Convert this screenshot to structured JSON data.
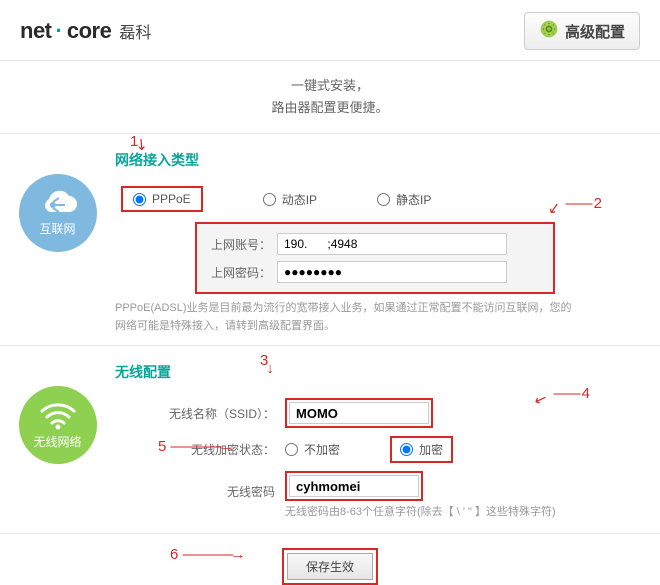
{
  "header": {
    "logo_net": "net",
    "logo_core": "core",
    "logo_cn": "磊科",
    "advanced_label": "高级配置"
  },
  "tagline": {
    "line1": "一键式安装，",
    "line2": "路由器配置更便捷。"
  },
  "internet": {
    "badge_label": "互联网",
    "title": "网络接入类型",
    "options": {
      "pppoe": "PPPoE",
      "dhcp": "动态IP",
      "static": "静态IP"
    },
    "selected": "pppoe",
    "account_label": "上网账号：",
    "account_value": "190.      ;4948",
    "password_label": "上网密码：",
    "password_value": "●●●●●●●●",
    "help": "PPPoE(ADSL)业务是目前最为流行的宽带接入业务，如果通过正常配置不能访问互联网，您的网络可能是特殊接入，请转到高级配置界面。"
  },
  "wireless": {
    "badge_label": "无线网络",
    "title": "无线配置",
    "ssid_label": "无线名称（SSID）：",
    "ssid_value": "MOMO",
    "enc_state_label": "无线加密状态：",
    "enc_off": "不加密",
    "enc_on": "加密",
    "enc_selected": "on",
    "pwd_label": "无线密码",
    "pwd_value": "cyhmomei",
    "pwd_hint": "无线密码由8-63个任意字符(除去【 \\ ' \" 】这些特殊字符)"
  },
  "footer": {
    "save_label": "保存生效"
  },
  "annotations": {
    "a1": "1",
    "a2": "2",
    "a3": "3",
    "a4": "4",
    "a5": "5",
    "a6": "6"
  }
}
